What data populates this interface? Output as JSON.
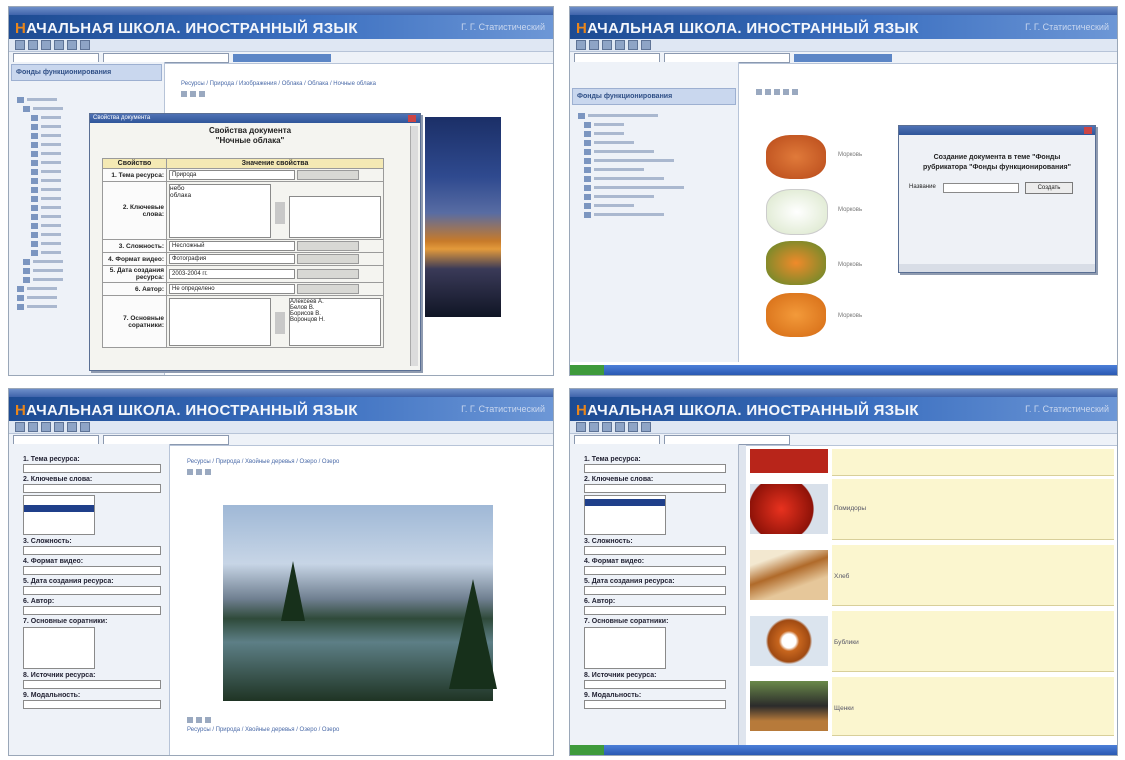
{
  "app": {
    "title_first_letter": "Н",
    "title_rest": "АЧАЛЬНАЯ ШКОЛА. ИНОСТРАННЫЙ ЯЗЫК",
    "brand": "Г. Г. Статистический"
  },
  "screen1": {
    "sidebar_head": "Фонды функционирования",
    "breadcrumb": "Ресурсы / Природа / Изображения / Облака / Облака / Ночные облака",
    "dialog_title": "Свойства документа",
    "heading_line1": "Свойства документа",
    "heading_line2": "\"Ночные облака\"",
    "col_property": "Свойство",
    "col_value": "Значение свойства",
    "rows": [
      {
        "label": "1. Тема ресурса:",
        "value": "Природа"
      },
      {
        "label": "2. Ключевые слова:",
        "value": "небо"
      },
      {
        "label": "3. Сложность:",
        "value": "Несложный"
      },
      {
        "label": "4. Формат видео:",
        "value": "Фотография"
      },
      {
        "label": "5. Дата создания ресурса:",
        "value": "2003-2004 гг."
      },
      {
        "label": "6. Автор:",
        "value": "Не определено"
      },
      {
        "label": "7. Основные соратники:",
        "value": ""
      }
    ],
    "keywords_list": [
      "небо",
      "облака"
    ],
    "authors_list": [
      "Алексеев А.",
      "Белов В.",
      "Борисов В.",
      "Воронцов Н."
    ]
  },
  "screen2": {
    "sidebar_head": "Фонды функционирования",
    "dialog_line1": "Создание документа в теме \"Фонды",
    "dialog_line2": "рубрикатора \"Фонды функционирования\"",
    "dialog_field_label": "Название",
    "dialog_button": "Создать",
    "veg_labels": [
      "Морковь",
      "Морковь",
      "Морковь",
      "Морковь"
    ]
  },
  "screen3": {
    "breadcrumb": "Ресурсы / Природа / Хвойные деревья / Озеро / Озеро",
    "form_labels": [
      "1. Тема ресурса:",
      "2. Ключевые слова:",
      "3. Сложность:",
      "4. Формат видео:",
      "5. Дата создания ресурса:",
      "6. Автор:",
      "7. Основные соратники:",
      "8. Источник ресурса:",
      "9. Модальность:"
    ],
    "bottom_crumbs": "Ресурсы / Природа / Хвойные деревья / Озеро / Озеро"
  },
  "screen4": {
    "form_labels": [
      "1. Тема ресурса:",
      "2. Ключевые слова:",
      "3. Сложность:",
      "4. Формат видео:",
      "5. Дата создания ресурса:",
      "6. Автор:",
      "7. Основные соратники:",
      "8. Источник ресурса:",
      "9. Модальность:"
    ],
    "row_labels": [
      "Помидоры",
      "Хлеб",
      "Бублики",
      "Щенки"
    ]
  }
}
